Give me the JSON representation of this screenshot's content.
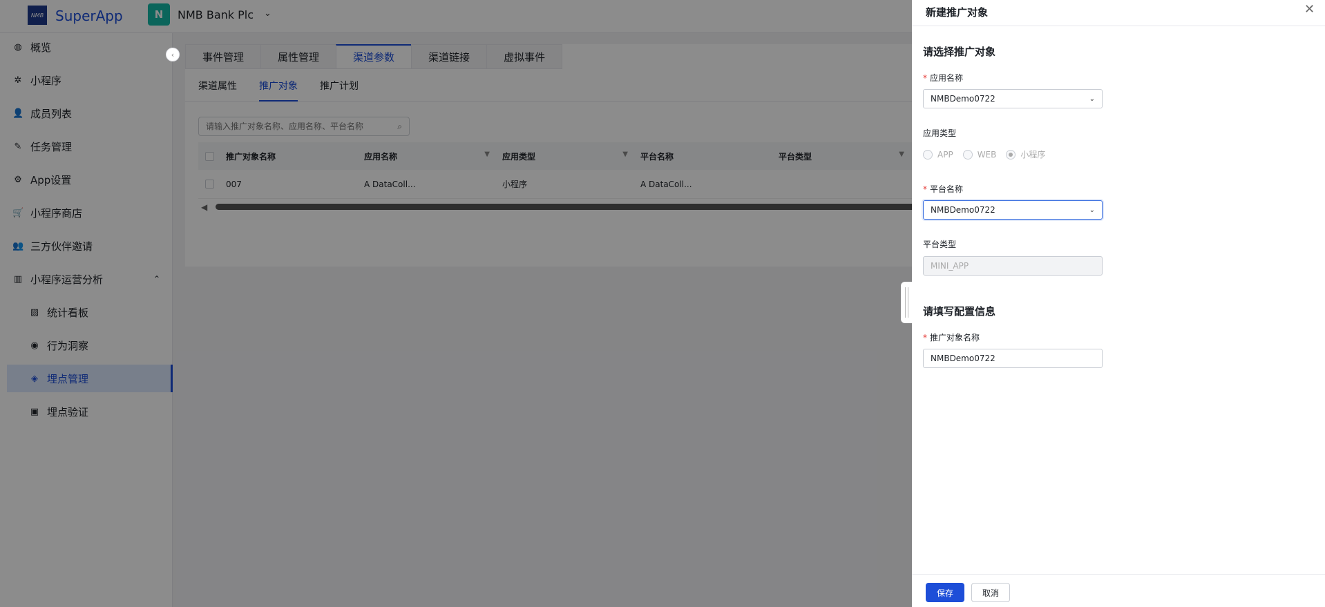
{
  "header": {
    "logo_text": "NMB",
    "app_name": "SuperApp",
    "org_initial": "N",
    "org_name": "NMB Bank Plc"
  },
  "sidebar": {
    "items": [
      {
        "label": "概览",
        "icon": "globe-icon"
      },
      {
        "label": "小程序",
        "icon": "aperture-icon"
      },
      {
        "label": "成员列表",
        "icon": "user-add-icon"
      },
      {
        "label": "任务管理",
        "icon": "tool-icon"
      },
      {
        "label": "App设置",
        "icon": "gear-icon"
      },
      {
        "label": "小程序商店",
        "icon": "cart-icon"
      },
      {
        "label": "三方伙伴邀请",
        "icon": "users-icon"
      },
      {
        "label": "小程序运营分析",
        "icon": "chart-icon",
        "expanded": true
      }
    ],
    "sub_items": [
      {
        "label": "统计看板",
        "icon": "image-icon"
      },
      {
        "label": "行为洞察",
        "icon": "eye-icon"
      },
      {
        "label": "埋点管理",
        "icon": "target-icon",
        "active": true
      },
      {
        "label": "埋点验证",
        "icon": "check-doc-icon"
      }
    ]
  },
  "main": {
    "tabs": [
      "事件管理",
      "属性管理",
      "渠道参数",
      "渠道链接",
      "虚拟事件"
    ],
    "active_tab": "渠道参数",
    "subtabs": [
      "渠道属性",
      "推广对象",
      "推广计划"
    ],
    "active_subtab": "推广对象",
    "search_placeholder": "请输入推广对象名称、应用名称、平台名称",
    "table": {
      "columns": [
        "推广对象名称",
        "应用名称",
        "应用类型",
        "平台名称",
        "平台类型"
      ],
      "rows": [
        [
          "007",
          "A DataColl...",
          "小程序",
          "A DataColl...",
          ""
        ]
      ]
    }
  },
  "drawer": {
    "title": "新建推广对象",
    "section1": "请选择推广对象",
    "app_name_label": "应用名称",
    "app_name_value": "NMBDemo0722",
    "app_type_label": "应用类型",
    "app_type_options": [
      "APP",
      "WEB",
      "小程序"
    ],
    "app_type_selected": "小程序",
    "platform_name_label": "平台名称",
    "platform_name_value": "NMBDemo0722",
    "platform_type_label": "平台类型",
    "platform_type_value": "MINI_APP",
    "section2": "请填写配置信息",
    "target_name_label": "推广对象名称",
    "target_name_value": "NMBDemo0722",
    "required_mark": "*",
    "save_label": "保存",
    "cancel_label": "取消"
  },
  "colors": {
    "accent": "#1d4ed8",
    "required": "#e53935",
    "org_avatar": "#14b8a6"
  }
}
